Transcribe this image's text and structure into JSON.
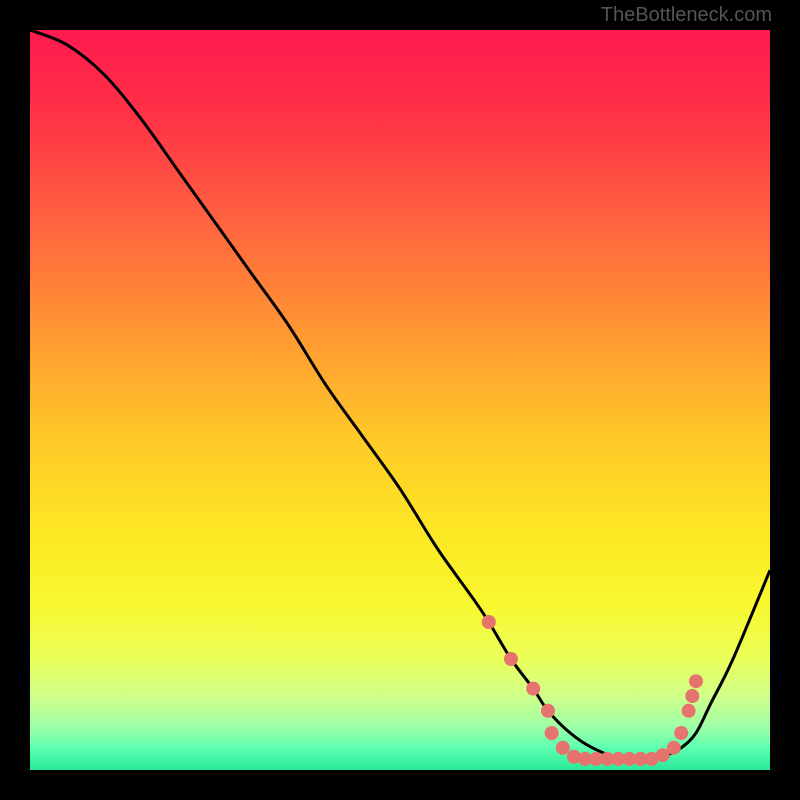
{
  "watermark": "TheBottleneck.com",
  "chart_data": {
    "type": "line",
    "title": "",
    "xlabel": "",
    "ylabel": "",
    "xlim": [
      0,
      100
    ],
    "ylim": [
      0,
      100
    ],
    "grid": false,
    "background": {
      "type": "vertical-gradient",
      "stops": [
        {
          "pos": 0.0,
          "color": "#ff1a50"
        },
        {
          "pos": 0.12,
          "color": "#ff3346"
        },
        {
          "pos": 0.25,
          "color": "#ff6040"
        },
        {
          "pos": 0.4,
          "color": "#ff9433"
        },
        {
          "pos": 0.55,
          "color": "#ffc828"
        },
        {
          "pos": 0.68,
          "color": "#fce824"
        },
        {
          "pos": 0.78,
          "color": "#f8f830"
        },
        {
          "pos": 0.85,
          "color": "#eaff5a"
        },
        {
          "pos": 0.9,
          "color": "#d0ff8a"
        },
        {
          "pos": 0.94,
          "color": "#a0ffa6"
        },
        {
          "pos": 0.97,
          "color": "#5effb0"
        },
        {
          "pos": 1.0,
          "color": "#28e89a"
        }
      ]
    },
    "series": [
      {
        "name": "bottleneck-curve",
        "color": "#000000",
        "x": [
          0,
          5,
          10,
          15,
          20,
          25,
          30,
          35,
          40,
          45,
          50,
          55,
          60,
          62,
          65,
          68,
          70,
          73,
          76,
          80,
          84,
          86,
          88,
          90,
          92,
          95,
          100
        ],
        "y": [
          100,
          98,
          94,
          88,
          81,
          74,
          67,
          60,
          52,
          45,
          38,
          30,
          23,
          20,
          15,
          11,
          8,
          5,
          3,
          1.5,
          1.5,
          2,
          3,
          5,
          9,
          15,
          27
        ]
      }
    ],
    "markers": {
      "name": "highlight-dots",
      "color": "#e6736e",
      "points": [
        {
          "x": 62,
          "y": 20
        },
        {
          "x": 65,
          "y": 15
        },
        {
          "x": 68,
          "y": 11
        },
        {
          "x": 70,
          "y": 8
        },
        {
          "x": 70.5,
          "y": 5
        },
        {
          "x": 72,
          "y": 3
        },
        {
          "x": 73.5,
          "y": 1.8
        },
        {
          "x": 75,
          "y": 1.5
        },
        {
          "x": 76.5,
          "y": 1.5
        },
        {
          "x": 78,
          "y": 1.5
        },
        {
          "x": 79.5,
          "y": 1.5
        },
        {
          "x": 81,
          "y": 1.5
        },
        {
          "x": 82.5,
          "y": 1.5
        },
        {
          "x": 84,
          "y": 1.5
        },
        {
          "x": 85.5,
          "y": 2
        },
        {
          "x": 87,
          "y": 3
        },
        {
          "x": 88,
          "y": 5
        },
        {
          "x": 89,
          "y": 8
        },
        {
          "x": 89.5,
          "y": 10
        },
        {
          "x": 90,
          "y": 12
        }
      ]
    }
  }
}
